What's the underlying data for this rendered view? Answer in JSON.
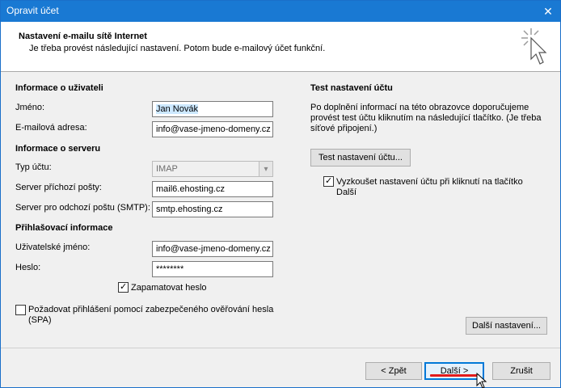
{
  "window": {
    "title": "Opravit účet",
    "close_glyph": "✕"
  },
  "header": {
    "title": "Nastavení e-mailu sítě Internet",
    "subtitle": "Je třeba provést následující nastavení. Potom bude e-mailový účet funkční."
  },
  "user_info": {
    "section": "Informace o uživateli",
    "name_label": "Jméno:",
    "name_value": "Jan Novák",
    "email_label": "E-mailová adresa:",
    "email_value": "info@vase-jmeno-domeny.cz"
  },
  "server_info": {
    "section": "Informace o serveru",
    "type_label": "Typ účtu:",
    "type_value": "IMAP",
    "incoming_label": "Server příchozí pošty:",
    "incoming_value": "mail6.ehosting.cz",
    "outgoing_label": "Server pro odchozí poštu (SMTP):",
    "outgoing_value": "smtp.ehosting.cz"
  },
  "login_info": {
    "section": "Přihlašovací informace",
    "username_label": "Uživatelské jméno:",
    "username_value": "info@vase-jmeno-domeny.cz",
    "password_label": "Heslo:",
    "password_value": "********",
    "remember_label": "Zapamatovat heslo",
    "remember_checked": true,
    "spa_label_line1": "Požadovat přihlášení pomocí zabezpečeného ověřování hesla",
    "spa_label_line2": "(SPA)",
    "spa_checked": false
  },
  "test_settings": {
    "section": "Test nastavení účtu",
    "desc_line1": "Po doplnění informací na této obrazovce doporučujeme",
    "desc_line2": "provést test účtu kliknutím na následující tlačítko. (Je třeba",
    "desc_line3": "síťové připojení.)",
    "test_button": "Test nastavení účtu...",
    "auto_test_line1": "Vyzkoušet nastavení účtu při kliknutí na tlačítko",
    "auto_test_line2": "Další",
    "auto_test_checked": true,
    "more_settings_button": "Další nastavení..."
  },
  "footer": {
    "back_button": "< Zpět",
    "next_button": "Další >",
    "cancel_button": "Zrušit"
  },
  "colors": {
    "titlebar": "#1979d3",
    "accent": "#0078d7",
    "highlight": "#e21b1b"
  }
}
